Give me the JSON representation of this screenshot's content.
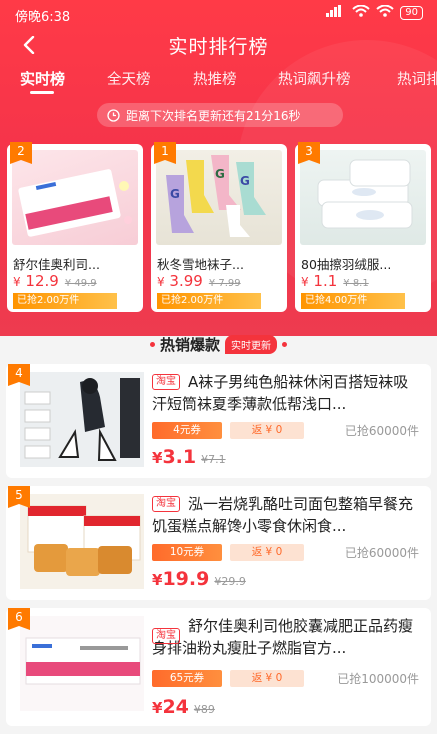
{
  "status": {
    "time": "傍晚6:38",
    "signal": "5G",
    "battery": "90"
  },
  "nav": {
    "title": "实时排行榜"
  },
  "tabs": [
    {
      "label": "实时榜",
      "active": true
    },
    {
      "label": "全天榜",
      "active": false
    },
    {
      "label": "热推榜",
      "active": false
    },
    {
      "label": "热词飙升榜",
      "active": false
    },
    {
      "label": "热词排",
      "active": false
    }
  ],
  "countdown": "距离下次排名更新还有21分16秒",
  "top": [
    {
      "rank": "2",
      "name": "舒尔佳奥利司...",
      "yen": "¥",
      "price": "12.9",
      "orig": "¥ 49.9",
      "sold": "已抢2.00万件"
    },
    {
      "rank": "1",
      "name": "秋冬雪地袜子...",
      "yen": "¥",
      "price": "3.99",
      "orig": "¥ 7.99",
      "sold": "已抢2.00万件"
    },
    {
      "rank": "3",
      "name": "80抽擦羽绒服...",
      "yen": "¥",
      "price": "1.1",
      "orig": "¥ 8.1",
      "sold": "已抢4.00万件"
    }
  ],
  "hot": {
    "title": "热销爆款",
    "tag": "实时更新"
  },
  "list": [
    {
      "rank": "4",
      "platform": "淘宝",
      "name": "A袜子男纯色船袜休闲百搭短袜吸汗短筒袜夏季薄款低帮浅口...",
      "coupon": "4元券",
      "rebate": "返 ¥ 0",
      "sold": "已抢60000件",
      "yen": "¥",
      "price": "3.1",
      "orig": "¥7.1"
    },
    {
      "rank": "5",
      "platform": "淘宝",
      "name": "泓一岩烧乳酪吐司面包整箱早餐充饥蛋糕点解馋小零食休闲食...",
      "coupon": "10元券",
      "rebate": "返 ¥ 0",
      "sold": "已抢60000件",
      "yen": "¥",
      "price": "19.9",
      "orig": "¥29.9"
    },
    {
      "rank": "6",
      "platform": "淘宝",
      "name": "舒尔佳奥利司他胶囊减肥正品药瘦身排油粉丸瘦肚子燃脂官方...",
      "coupon": "65元券",
      "rebate": "返 ¥ 0",
      "sold": "已抢100000件",
      "yen": "¥",
      "price": "24",
      "orig": "¥89"
    }
  ]
}
